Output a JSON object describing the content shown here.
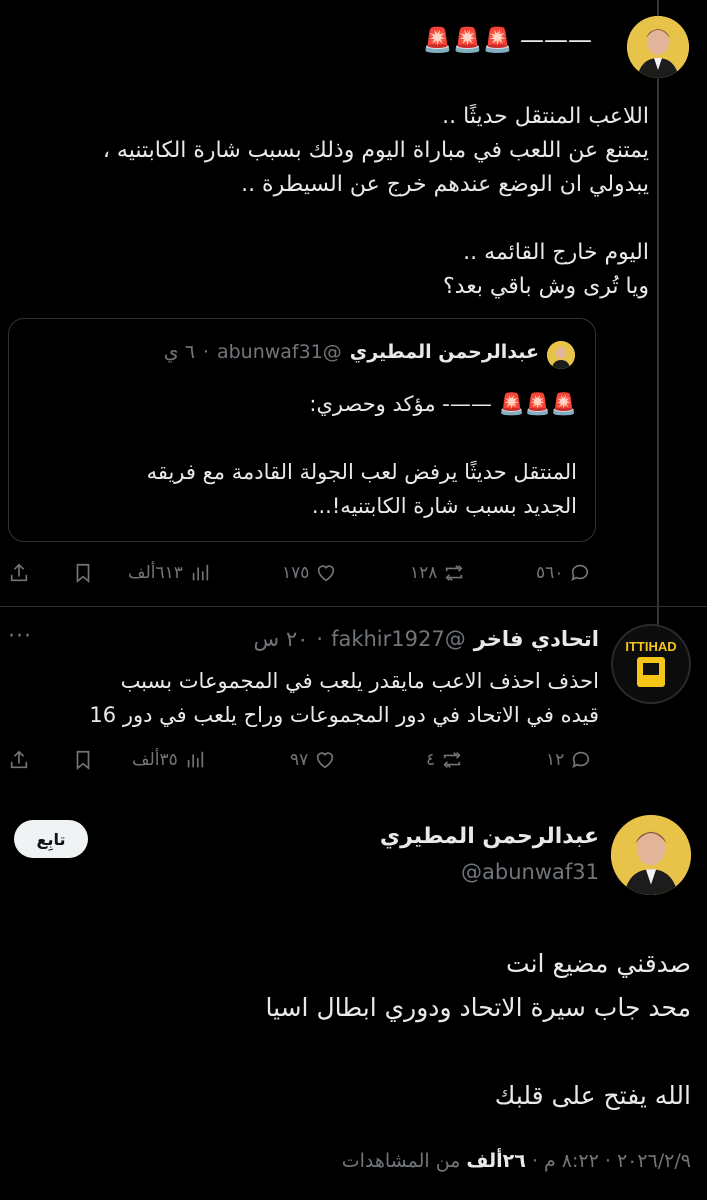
{
  "tweet1": {
    "header_line": "🚨🚨🚨 ———",
    "body": [
      "اللاعب المنتقل حديثًا ..",
      "يمتنع عن اللعب في مباراة اليوم وذلك بسبب شارة الكابتنيه ،",
      "يبدولي ان الوضع عندهم خرج عن السيطرة ..",
      "",
      "اليوم خارج القائمه ..",
      "ويا تُرى وش باقي بعد؟"
    ],
    "quote": {
      "name": "عبدالرحمن المطيري",
      "handle": "@abunwaf31",
      "time": "٦ ي",
      "line1": "🚨🚨🚨 ——- مؤكد وحصري:",
      "line2": "المنتقل حديثًا يرفض لعب الجولة القادمة مع فريقه",
      "line3": "الجديد بسبب شارة الكابتنيه!..."
    },
    "actions": {
      "replies": "٥٦٠",
      "reposts": "١٢٨",
      "likes": "١٧٥",
      "views": "٦١٣ألف"
    }
  },
  "reply": {
    "name": "اتحادي فاخر",
    "handle": "@fakhir1927",
    "time": "٢٠ س",
    "avatar_text": "ITTIHAD",
    "body": [
      "احذف احذف الاعب مايقدر يلعب في المجموعات بسبب",
      "قيده في الاتحاد في دور المجموعات وراح يلعب في دور 16"
    ],
    "actions": {
      "replies": "١٢",
      "reposts": "٤",
      "likes": "٩٧",
      "views": "٣٥ألف"
    }
  },
  "main": {
    "name": "عبدالرحمن المطيري",
    "handle": "@abunwaf31",
    "follow_label": "تابِع",
    "body": [
      "صدقني مضيع انت",
      "محد جاب سيرة الاتحاد ودوري ابطال اسيا",
      "",
      "الله يفتح على قلبك"
    ],
    "meta_time": "٢٠٢٦/٢/٩ · ٨:٢٢ م · ",
    "meta_views_num": "٢٦ألف",
    "meta_views_label": " من المشاهدات"
  }
}
